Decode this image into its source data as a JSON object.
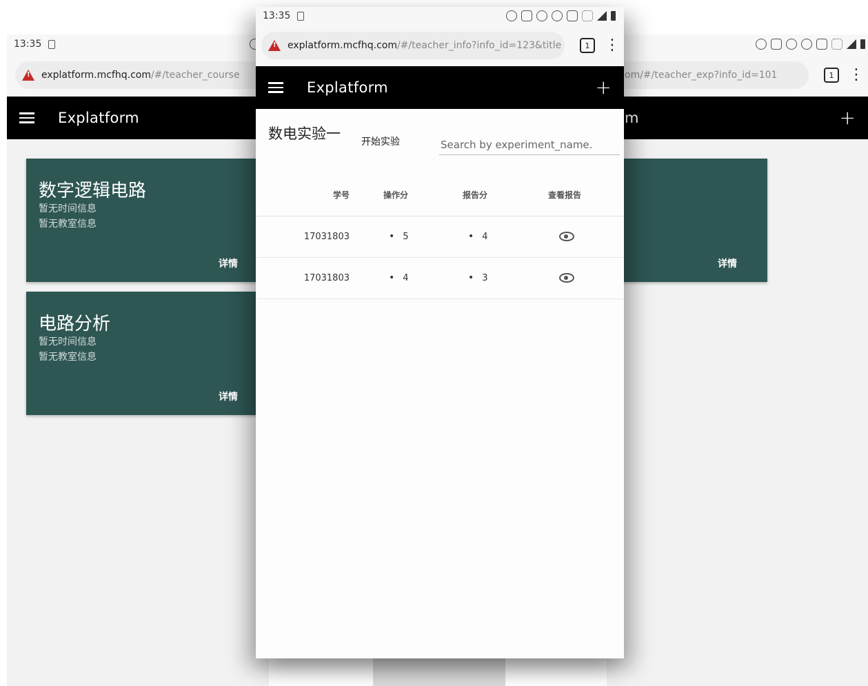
{
  "colors": {
    "card": "#2e5653",
    "toolbar": "#000000",
    "warning": "#c62828"
  },
  "back_left": {
    "status_time": "13:35",
    "url_host": "explatform.mcfhq.com",
    "url_path": "/#/teacher_course",
    "app_title": "Explatform",
    "courses": [
      {
        "title": "数字逻辑电路",
        "time": "暂无时间信息",
        "room": "暂无教室信息",
        "detail": "详情"
      },
      {
        "title": "电路分析",
        "time": "暂无时间信息",
        "room": "暂无教室信息",
        "detail": "详情"
      }
    ]
  },
  "back_right": {
    "url_path": "om/#/teacher_exp?info_id=101",
    "tab_count": "1",
    "title_fragment": "m",
    "add_icon": "+",
    "card_detail": "详情"
  },
  "front": {
    "status_time": "13:35",
    "url_host": "explatform.mcfhq.com",
    "url_path": "/#/teacher_info?info_id=123&title",
    "tab_count": "1",
    "app_title": "Explatform",
    "add_icon": "+",
    "experiment_title": "数电实验一",
    "start_label": "开始实验",
    "search_placeholder": "Search by experiment_name.",
    "columns": [
      "学号",
      "操作分",
      "报告分",
      "查看报告"
    ],
    "rows": [
      {
        "student_id": "17031803",
        "op_score": "5",
        "report_score": "4"
      },
      {
        "student_id": "17031803",
        "op_score": "4",
        "report_score": "3"
      }
    ]
  }
}
